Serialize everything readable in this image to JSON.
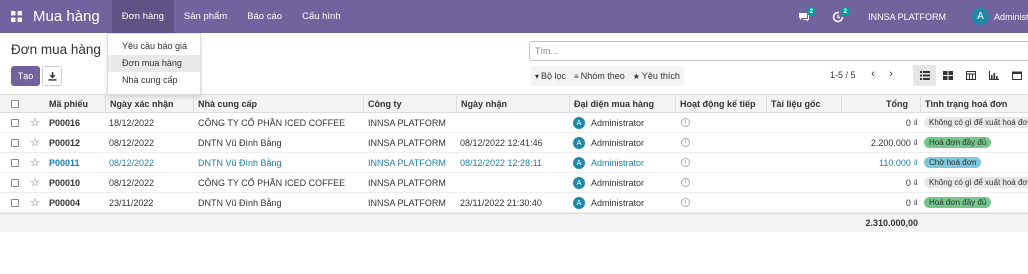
{
  "navbar": {
    "app_name": "Mua hàng",
    "menu": [
      "Đơn hàng",
      "Sản phẩm",
      "Báo cáo",
      "Cấu hình"
    ],
    "messages_count": "2",
    "activities_count": "2",
    "company": "INNSA PLATFORM",
    "user_initial": "A",
    "user_name": "Administrator"
  },
  "dropdown": [
    "Yêu cầu báo giá",
    "Đơn mua hàng",
    "Nhà cung cấp"
  ],
  "control": {
    "title": "Đơn mua hàng",
    "create_label": "Tạo",
    "search_placeholder": "Tìm...",
    "filter_label": "Bộ lọc",
    "group_label": "Nhóm theo",
    "favorite_label": "Yêu thích",
    "pager": "1-5 / 5"
  },
  "table": {
    "headers": {
      "ref": "Mã phiếu",
      "date": "Ngày xác nhận",
      "vendor": "Nhà cung cấp",
      "company": "Công ty",
      "receipt": "Ngày nhận",
      "rep": "Đại diện mua hàng",
      "activity": "Hoạt động kế tiếp",
      "source": "Tài liệu gốc",
      "total": "Tổng",
      "invoice": "Tình trạng hoá đơn"
    },
    "rows": [
      {
        "ref": "P00016",
        "date": "18/12/2022",
        "vendor": "CÔNG TY CỔ PHẦN ICED COFFEE",
        "company": "INNSA PLATFORM",
        "receipt": "",
        "rep_initial": "A",
        "rep": "Administrator",
        "total": "0 ₫",
        "invoice": "Không có gì để xuất hoá đơn"
      },
      {
        "ref": "P00012",
        "date": "08/12/2022",
        "vendor": "DNTN Vũ Đình Bằng",
        "company": "INNSA PLATFORM",
        "receipt": "08/12/2022 12:41:46",
        "rep_initial": "A",
        "rep": "Administrator",
        "total": "2.200.000 ₫",
        "invoice": "Hoá đơn đầy đủ"
      },
      {
        "ref": "P00011",
        "date": "08/12/2022",
        "vendor": "DNTN Vũ Đình Bằng",
        "company": "INNSA PLATFORM",
        "receipt": "08/12/2022 12:28:11",
        "rep_initial": "A",
        "rep": "Administrator",
        "total": "110.000 ₫",
        "invoice": "Chờ hoá đơn"
      },
      {
        "ref": "P00010",
        "date": "08/12/2022",
        "vendor": "CÔNG TY CỔ PHẦN ICED COFFEE",
        "company": "INNSA PLATFORM",
        "receipt": "",
        "rep_initial": "A",
        "rep": "Administrator",
        "total": "0 ₫",
        "invoice": "Không có gì để xuất hoá đơn"
      },
      {
        "ref": "P00004",
        "date": "23/11/2022",
        "vendor": "DNTN Vũ Đình Bằng",
        "company": "INNSA PLATFORM",
        "receipt": "23/11/2022 21:30:40",
        "rep_initial": "A",
        "rep": "Administrator",
        "total": "0 ₫",
        "invoice": "Hoá đơn đầy đủ"
      }
    ],
    "sum_total": "2.310.000,00"
  },
  "colors": {
    "brand": "#71639e",
    "link": "#1d7fa8",
    "tag_full": "#74c68a",
    "tag_wait": "#7fc5db"
  }
}
